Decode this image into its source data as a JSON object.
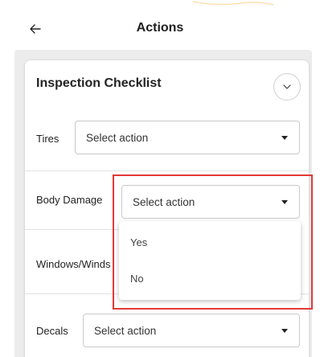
{
  "header": {
    "title": "Actions",
    "back_icon": "arrow-left-icon"
  },
  "card": {
    "title": "Inspection Checklist",
    "collapse_icon": "chevron-down-icon"
  },
  "rows": [
    {
      "label": "Tires",
      "value": "Select action"
    },
    {
      "label": "Body Damage",
      "value": "Select action"
    },
    {
      "label": "Windows/Winds"
    },
    {
      "label": "Decals",
      "value": "Select action"
    }
  ],
  "dropdown_menu": {
    "options": [
      "Yes",
      "No"
    ]
  },
  "colors": {
    "highlight": "#e53935",
    "accent": "#f5a623"
  }
}
